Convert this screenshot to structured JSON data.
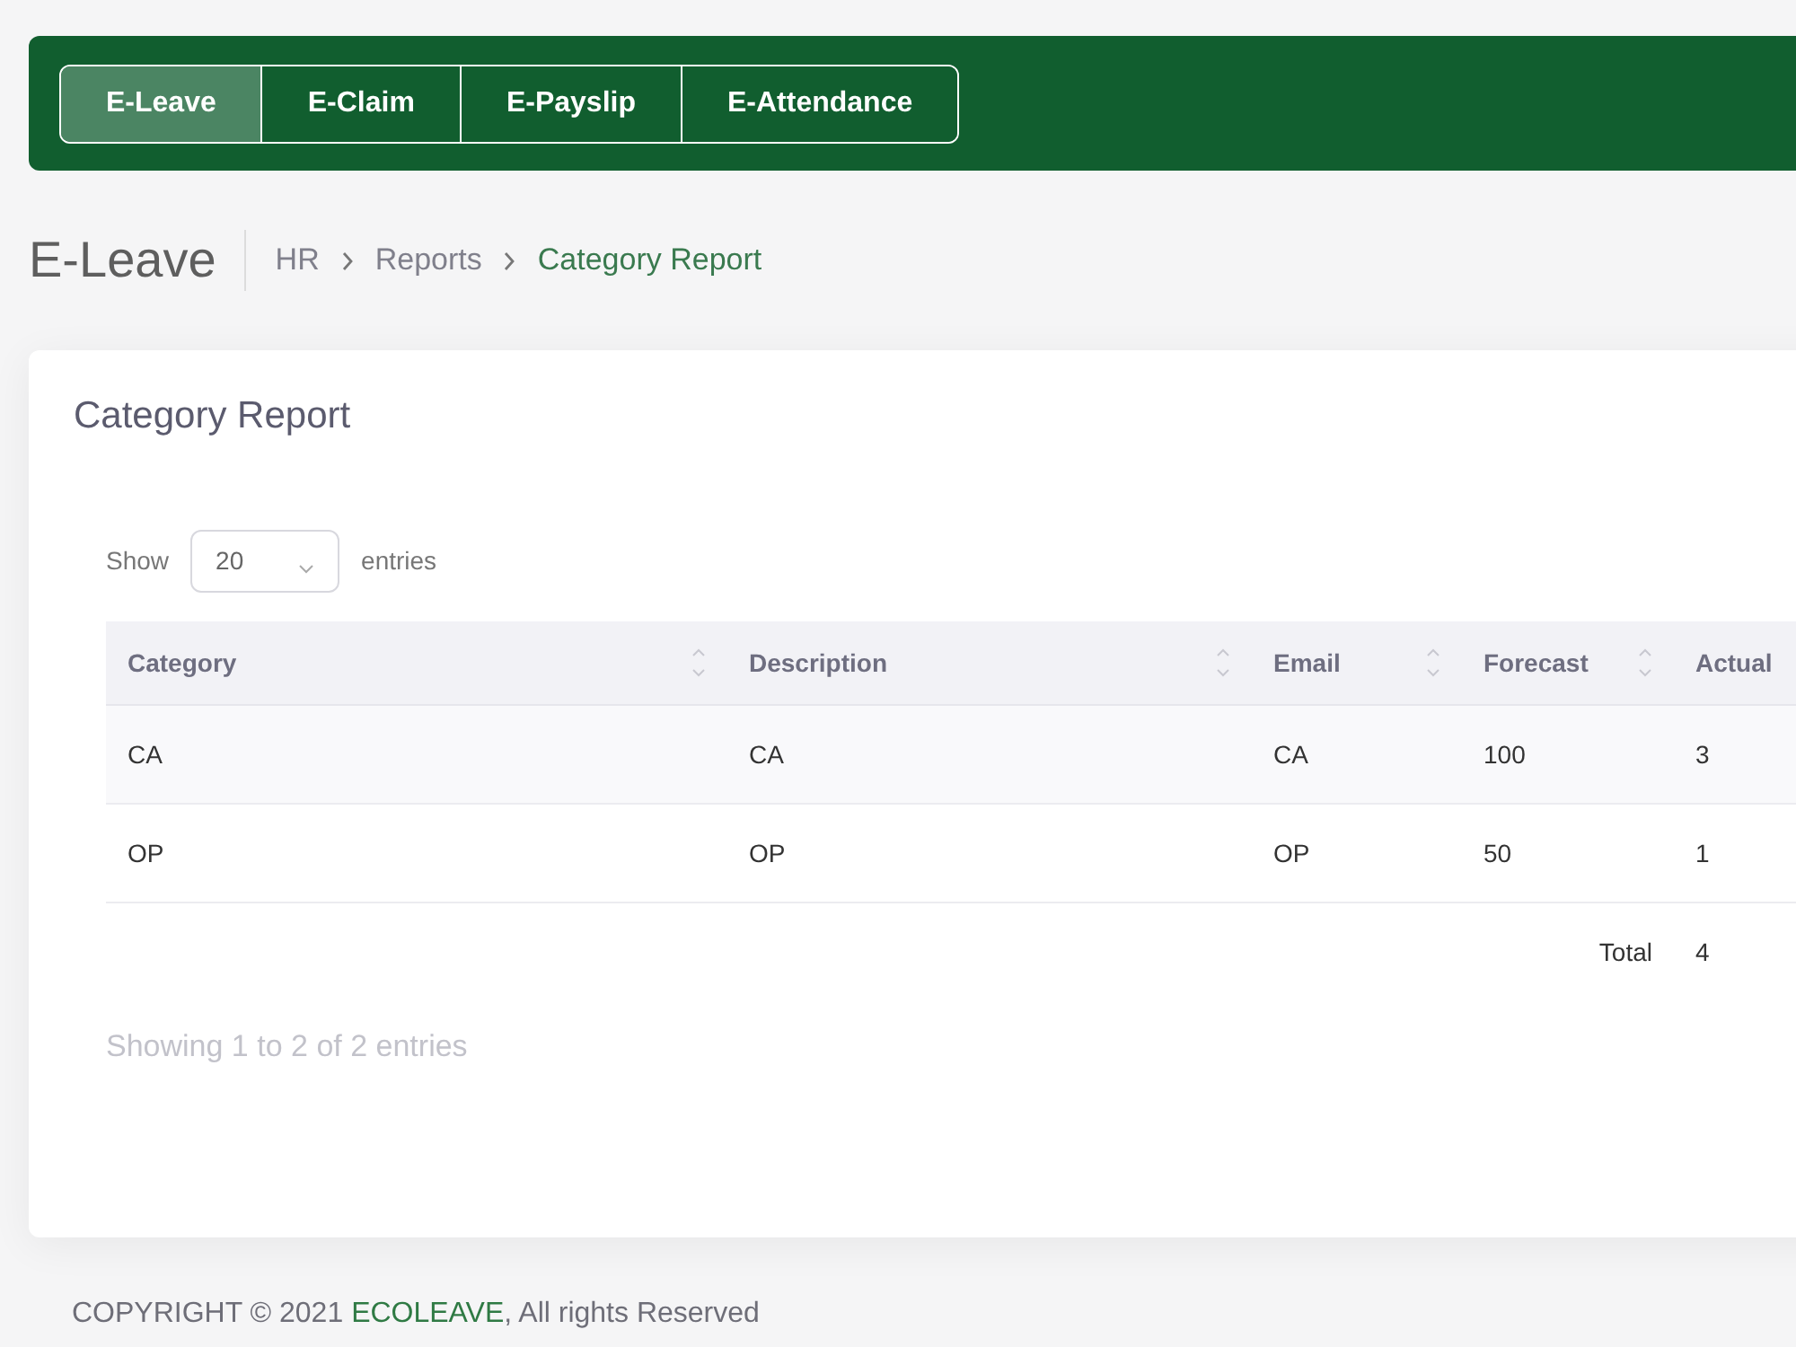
{
  "nav_tabs": [
    {
      "label": "E-Leave",
      "selected": true
    },
    {
      "label": "E-Claim",
      "selected": false
    },
    {
      "label": "E-Payslip",
      "selected": false
    },
    {
      "label": "E-Attendance",
      "selected": false
    }
  ],
  "page_title": "E-Leave",
  "breadcrumb": [
    {
      "label": "HR",
      "current": false
    },
    {
      "label": "Reports",
      "current": false
    },
    {
      "label": "Category Report",
      "current": true
    }
  ],
  "card": {
    "title": "Category Report",
    "length_control": {
      "show_label": "Show",
      "value": "20",
      "entries_label": "entries"
    },
    "table": {
      "columns": [
        "Category",
        "Description",
        "Email",
        "Forecast",
        "Actual"
      ],
      "rows": [
        [
          "CA",
          "CA",
          "CA",
          "100",
          "3"
        ],
        [
          "OP",
          "OP",
          "OP",
          "50",
          "1"
        ]
      ],
      "total": {
        "label": "Total",
        "value": "4"
      }
    },
    "info": "Showing 1 to 2 of 2 entries"
  },
  "footer": {
    "prefix": "COPYRIGHT © 2021",
    "link": "ECOLEAVE",
    "suffix": ", All rights Reserved"
  }
}
